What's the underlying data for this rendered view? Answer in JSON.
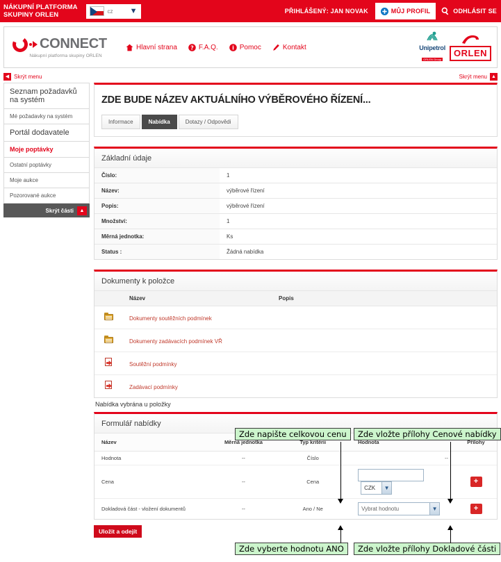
{
  "topbar": {
    "platform_title": "NÁKUPNÍ PLATFORMA\nSKUPINY ORLEN",
    "lang_code": "cz",
    "logged_as": "PŘIHLÁŠENÝ: JAN NOVAK",
    "profile_label": "MŮJ PROFIL",
    "logout_label": "ODHLÁSIT SE"
  },
  "header": {
    "logo_word": "CONNECT",
    "logo_subtitle": "Nákupní platforma skupiny ORLEN",
    "nav": [
      {
        "label": "Hlavní strana",
        "icon": "home-icon"
      },
      {
        "label": "F.A.Q.",
        "icon": "question-icon"
      },
      {
        "label": "Pomoc",
        "icon": "info-icon"
      },
      {
        "label": "Kontakt",
        "icon": "pen-icon"
      }
    ],
    "partner_unipetrol": "Unipetrol",
    "partner_unipetrol_sub": "ORLEN Group",
    "partner_orlen": "ORLEN"
  },
  "hidebar": {
    "left_label": "Skrýt menu",
    "right_label": "Skrýt menu"
  },
  "sidebar": {
    "items": [
      {
        "label": "Seznam požadavků na systém",
        "type": "head"
      },
      {
        "label": "Mé požadavky na systém",
        "type": "sub"
      },
      {
        "label": "Portál dodavatele",
        "type": "head"
      },
      {
        "label": "Moje poptávky",
        "type": "active"
      },
      {
        "label": "Ostatní poptávky",
        "type": "sub"
      },
      {
        "label": "Moje aukce",
        "type": "sub"
      },
      {
        "label": "Pozorované aukce",
        "type": "sub"
      }
    ],
    "footer_label": "Skrýt části"
  },
  "main": {
    "page_title": "ZDE BUDE NÁZEV AKTUÁLNÍHO VÝBĚROVÉHO ŘÍZENÍ...",
    "tabs": [
      {
        "label": "Informace",
        "active": false
      },
      {
        "label": "Nabídka",
        "active": true
      },
      {
        "label": "Dotazy / Odpovědi",
        "active": false
      }
    ]
  },
  "basic_info": {
    "section_title": "Základní údaje",
    "rows": [
      {
        "label": "Číslo:",
        "value": "1"
      },
      {
        "label": "Název:",
        "value": "výběrové řízení"
      },
      {
        "label": "Popis:",
        "value": "výběrové řízení"
      },
      {
        "label": "Množství:",
        "value": "1"
      },
      {
        "label": "Měrná jednotka:",
        "value": "Ks"
      },
      {
        "label": "Status :",
        "value": "Žádná nabídka"
      }
    ]
  },
  "documents": {
    "section_title": "Dokumenty k položce",
    "columns": {
      "icon": "",
      "name": "Název",
      "desc": "Popis"
    },
    "rows": [
      {
        "icon": "folder-icon",
        "name": "Dokumenty soutěžních podmínek",
        "desc": ""
      },
      {
        "icon": "folder-icon",
        "name": "Dokumenty zadávacích podmínek VŘ",
        "desc": ""
      },
      {
        "icon": "pdf-icon",
        "name": "Soutěžní podmínky",
        "desc": ""
      },
      {
        "icon": "pdf-icon",
        "name": "Zadávací podmínky",
        "desc": ""
      }
    ]
  },
  "offer": {
    "note": "Nabídka vybrána u položky",
    "section_title": "Formulář nabídky",
    "columns": {
      "name": "Název",
      "unit": "Měrná jednotka",
      "type": "Typ kritérii",
      "value": "Hodnota",
      "attachments": "Přílohy"
    },
    "rows": [
      {
        "name": "Hodnota",
        "unit": "--",
        "type": "Číslo",
        "value_kind": "dash",
        "value": "--",
        "attachment": false
      },
      {
        "name": "Cena",
        "unit": "--",
        "type": "Cena",
        "value_kind": "input-currency",
        "value": "",
        "currency": "CZK",
        "attachment": true
      },
      {
        "name": "Dokladová část - vložení dokumentů",
        "unit": "--",
        "type": "Ano / Ne",
        "value_kind": "select",
        "value": "Vybrat hodnotu",
        "attachment": true
      }
    ],
    "save_label": "Uložit a odejít"
  },
  "annotations": [
    {
      "text": "Zde napište celkovou cenu"
    },
    {
      "text": "Zde vložte přílohy Cenové nabídky"
    },
    {
      "text": "Zde vyberte hodnotu ANO"
    },
    {
      "text": "Zde vložte přílohy Dokladové části"
    }
  ],
  "colors": {
    "brand_red": "#e3051b",
    "dark_gray": "#585858",
    "annotation_green": "#ccf5cc"
  }
}
